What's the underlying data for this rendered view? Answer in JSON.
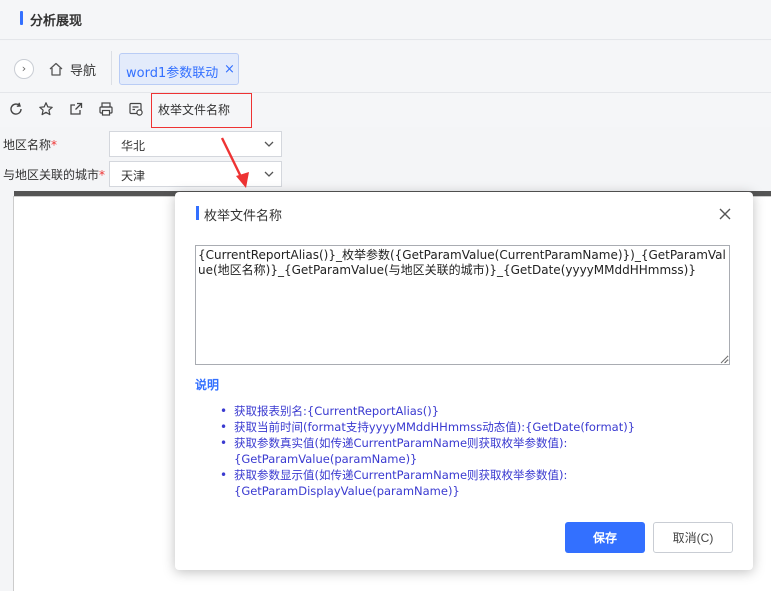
{
  "header": {
    "title": "分析展现"
  },
  "tabs": {
    "nav_label": "导航",
    "active_tab": "word1参数联动",
    "close_glyph": "×",
    "collapse_glyph": "›"
  },
  "toolbar": {
    "icons": [
      "refresh-icon",
      "star-icon",
      "external-link-icon",
      "print-icon",
      "settings-doc-icon"
    ],
    "enum_label": "枚举文件名称"
  },
  "params": [
    {
      "label": "地区名称",
      "required": "*",
      "value": "华北"
    },
    {
      "label": "与地区关联的城市",
      "required": "*",
      "value": "天津"
    }
  ],
  "dialog": {
    "title": "枚举文件名称",
    "textarea_value": "{CurrentReportAlias()}_枚举参数({GetParamValue(CurrentParamName)})_{GetParamValue(地区名称)}_{GetParamValue(与地区关联的城市)}_{GetDate(yyyyMMddHHmmss)}",
    "explain_heading": "说明",
    "items": [
      "获取报表别名:{CurrentReportAlias()}",
      "获取当前时间(format支持yyyyMMddHHmmss动态值):{GetDate(format)}",
      "获取参数真实值(如传递CurrentParamName则获取枚举参数值):{GetParamValue(paramName)}",
      "获取参数显示值(如传递CurrentParamName则获取枚举参数值):{GetParamDisplayValue(paramName)}"
    ],
    "save_label": "保存",
    "cancel_label": "取消(C)"
  },
  "colors": {
    "accent": "#3370ff",
    "highlight_box": "#ee3333",
    "arrow": "#ee3333",
    "link_text": "#3a3ad0"
  }
}
